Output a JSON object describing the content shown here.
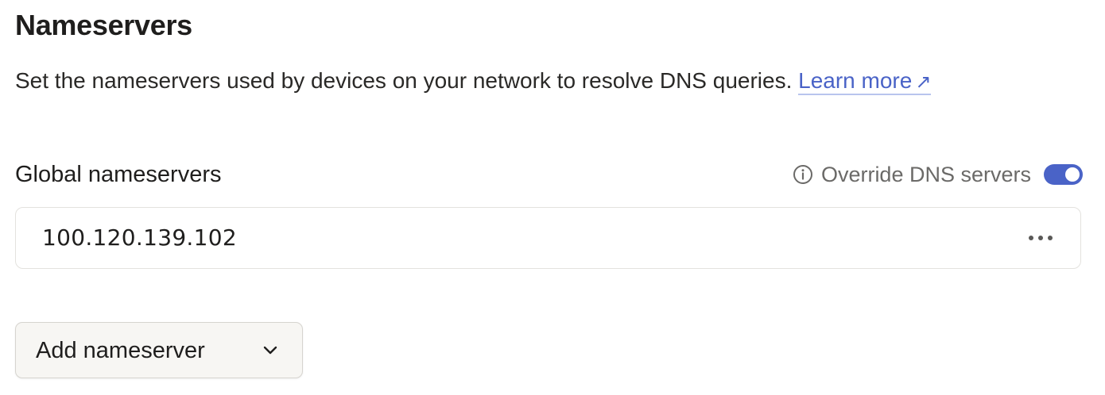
{
  "section": {
    "title": "Nameservers",
    "description": "Set the nameservers used by devices on your network to resolve DNS queries. ",
    "learn_more": "Learn more",
    "learn_more_arrow": "↗"
  },
  "global": {
    "label": "Global nameservers",
    "override_label": "Override DNS servers",
    "override_enabled": true,
    "nameservers": [
      "100.120.139.102"
    ]
  },
  "add_button": {
    "label": "Add nameserver"
  },
  "colors": {
    "accent": "#4a63c7",
    "text": "#1f1e1d",
    "muted": "#6b6a68",
    "border": "#e3e2de"
  },
  "icons": {
    "info": "info-icon",
    "more": "more-horizontal-icon",
    "chevron": "chevron-down-icon",
    "external": "arrow-up-right-icon"
  }
}
